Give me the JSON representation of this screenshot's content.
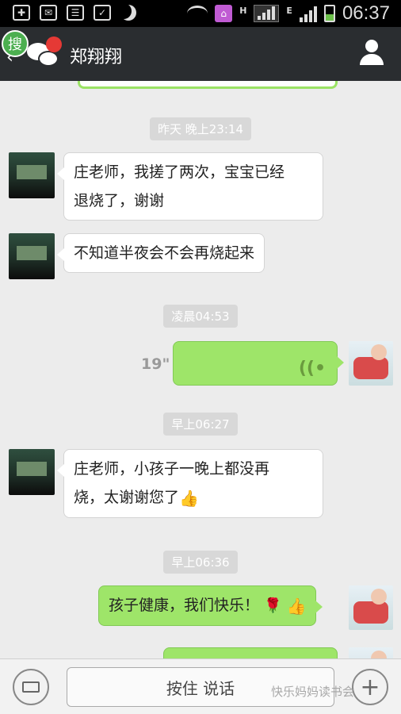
{
  "status_bar": {
    "time": "06:37",
    "letters": [
      "H",
      "E"
    ],
    "icons": [
      "add-icon",
      "mail-icon",
      "clipboard-icon",
      "shield-icon",
      "moon-icon",
      "wifi-icon",
      "home-icon",
      "signal-icon",
      "battery-icon"
    ]
  },
  "header": {
    "contact_name": "郑翔翔",
    "search_badge": "搜"
  },
  "chat": {
    "messages": [
      {
        "type": "timestamp",
        "text": "昨天 晚上23:14"
      },
      {
        "type": "text",
        "side": "left",
        "lines": [
          "庄老师，我搓了两次，宝宝已经",
          "退烧了，谢谢"
        ]
      },
      {
        "type": "text",
        "side": "left",
        "lines": [
          "不知道半夜会不会再烧起来"
        ]
      },
      {
        "type": "timestamp",
        "text": "凌晨04:53"
      },
      {
        "type": "voice",
        "side": "right",
        "duration": "19\""
      },
      {
        "type": "timestamp",
        "text": "早上06:27"
      },
      {
        "type": "text",
        "side": "left",
        "lines": [
          "庄老师，小孩子一晚上都没再",
          "烧，太谢谢您了"
        ],
        "emoji": "thumbs-up"
      },
      {
        "type": "timestamp",
        "text": "早上06:36"
      },
      {
        "type": "text",
        "side": "right",
        "lines": [
          "孩子健康，我们快乐！"
        ],
        "emoji": [
          "rose",
          "thumbs-up"
        ]
      }
    ]
  },
  "input_bar": {
    "hold_to_talk_label": "按住 说话",
    "watermark": "快乐妈妈读书会"
  }
}
